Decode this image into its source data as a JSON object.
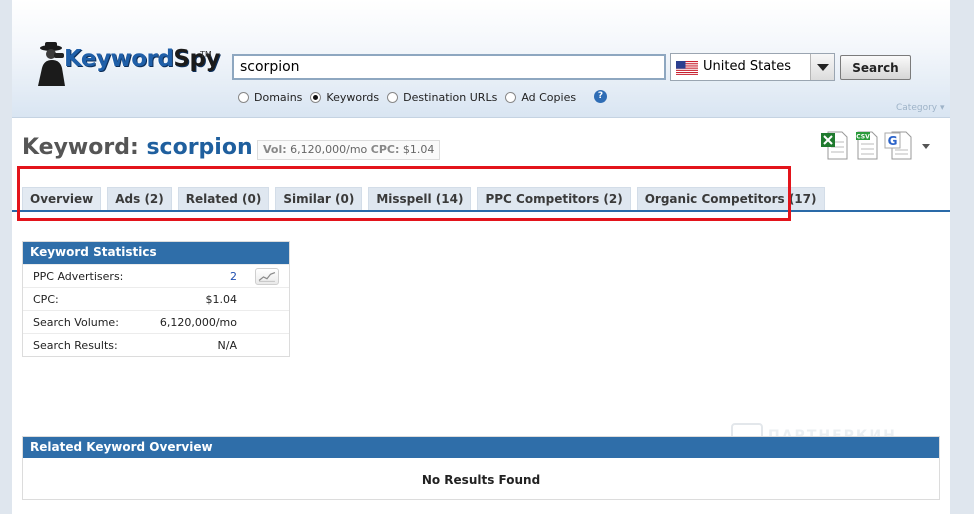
{
  "header": {
    "logo": {
      "part1": "Keyword",
      "part2": "Spy",
      "tm": "TM"
    },
    "search": {
      "value": "scorpion"
    },
    "country": {
      "label": "United States"
    },
    "search_button": "Search",
    "radio_options": [
      {
        "label": "Domains",
        "selected": false
      },
      {
        "label": "Keywords",
        "selected": true
      },
      {
        "label": "Destination URLs",
        "selected": false
      },
      {
        "label": "Ad Copies",
        "selected": false
      }
    ],
    "help": "?",
    "category": "Category ▾"
  },
  "keyword": {
    "prefix": "Keyword:",
    "term": "scorpion",
    "vol_label": "Vol:",
    "vol_value": "6,120,000/mo",
    "cpc_label": "CPC:",
    "cpc_value": "$1.04"
  },
  "exports": [
    {
      "icon": "excel-export-icon",
      "label": ""
    },
    {
      "icon": "csv-export-icon",
      "label": "CSV"
    },
    {
      "icon": "google-export-icon",
      "label": "G"
    }
  ],
  "tabs": [
    {
      "label": "Overview"
    },
    {
      "label": "Ads (2)"
    },
    {
      "label": "Related (0)"
    },
    {
      "label": "Similar (0)"
    },
    {
      "label": "Misspell (14)"
    },
    {
      "label": "PPC Competitors (2)"
    },
    {
      "label": "Organic Competitors (17)"
    }
  ],
  "keyword_statistics": {
    "title": "Keyword Statistics",
    "rows": [
      {
        "label": "PPC Advertisers:",
        "value": "2"
      },
      {
        "label": "CPC:",
        "value": "$1.04"
      },
      {
        "label": "Search Volume:",
        "value": "6,120,000/mo"
      },
      {
        "label": "Search Results:",
        "value": "N/A"
      }
    ]
  },
  "related_overview": {
    "title": "Related Keyword Overview",
    "empty_text": "No Results Found"
  },
  "watermark": {
    "text": "ПАРТНЕРКИН"
  },
  "colors": {
    "accent_blue": "#2f6ea9",
    "keyword_blue": "#1f5f9e",
    "highlight_red": "#e3141b",
    "tab_bg": "#dfe7f0"
  }
}
